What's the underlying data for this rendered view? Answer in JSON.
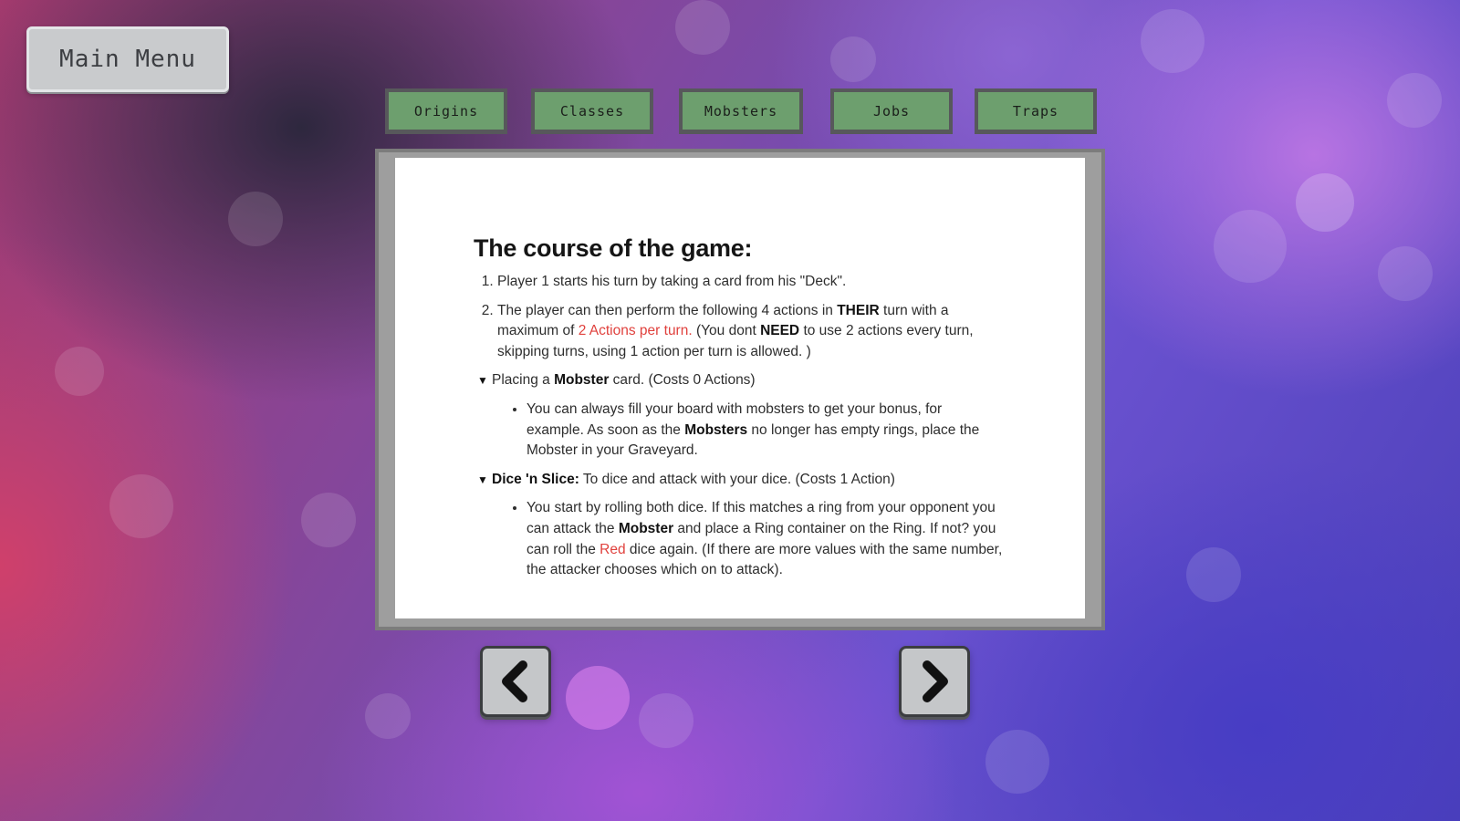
{
  "header": {
    "main_menu_label": "Main Menu"
  },
  "tabs": [
    {
      "label": "Origins"
    },
    {
      "label": "Classes"
    },
    {
      "label": "Mobsters"
    },
    {
      "label": "Jobs"
    },
    {
      "label": "Traps"
    }
  ],
  "document": {
    "title": "The course of the game:",
    "step1": "Player 1 starts his turn by taking a card from his \"Deck\".",
    "step2": {
      "a": "The player can then perform the following 4 actions in ",
      "b": "THEIR",
      "c": " turn with a maximum of ",
      "d": "2 Actions per turn.",
      "e": " (You dont ",
      "f": "NEED",
      "g": " to use 2 actions every turn, skipping turns, using 1 action per turn is allowed. )"
    },
    "toggle1": {
      "a": "Placing a ",
      "b": "Mobster",
      "c": " card. (Costs 0 Actions)"
    },
    "bullet1": {
      "a": "You can always fill your board with mobsters to get your bonus, for example. As soon as the ",
      "b": "Mobsters",
      "c": " no longer has empty rings, place the Mobster in your Graveyard."
    },
    "toggle2": {
      "a": "Dice 'n Slice:",
      "b": " To dice and attack with your dice. (Costs 1 Action)"
    },
    "bullet2": {
      "a": "You start by rolling both dice. If this matches a ring from your opponent you can attack the ",
      "b": "Mobster",
      "c": " and place a Ring container on the Ring. If not? you can roll the ",
      "d": "Red",
      "e": " dice again. (If there are more values with the same number, the attacker chooses which on to attack)."
    }
  },
  "navigation": {
    "prev_icon": "chevron-left-icon",
    "next_icon": "chevron-right-icon"
  },
  "colors": {
    "tab_green": "#6d9f6e",
    "button_gray": "#c9cbcd",
    "panel_gray": "#9e9e9e",
    "highlight_red": "#e0413d"
  }
}
